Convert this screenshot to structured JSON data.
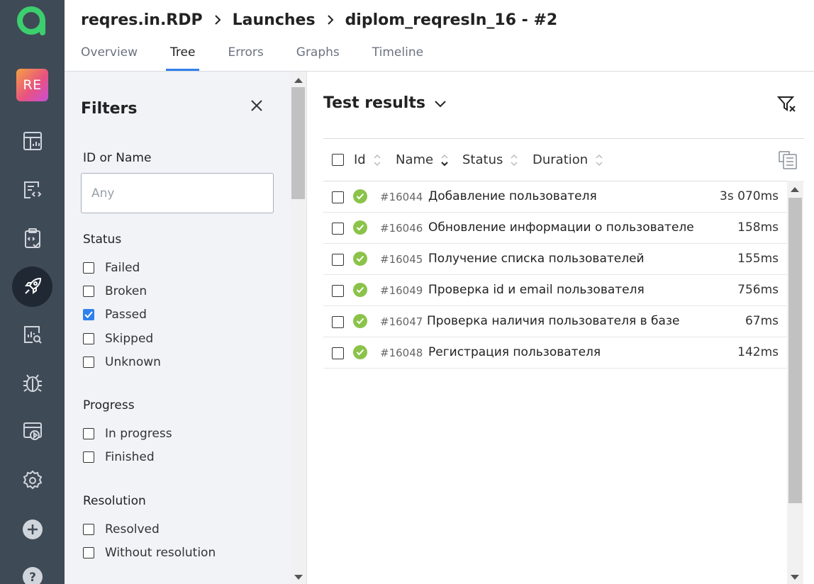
{
  "breadcrumb": {
    "project": "reqres.in.RDP",
    "launches": "Launches",
    "launch": "diplom_reqresIn_16 - #2"
  },
  "tabs": [
    {
      "label": "Overview"
    },
    {
      "label": "Tree"
    },
    {
      "label": "Errors"
    },
    {
      "label": "Graphs"
    },
    {
      "label": "Timeline"
    }
  ],
  "active_tab": "Tree",
  "rail": {
    "project_initials": "RE",
    "icons": [
      "dashboard-icon",
      "reports-icon",
      "test-plan-icon",
      "launches-icon",
      "analytics-icon",
      "defects-icon",
      "jobs-icon",
      "settings-icon",
      "add-icon",
      "help-icon"
    ]
  },
  "filters": {
    "title": "Filters",
    "id_or_name": {
      "label": "ID or Name",
      "placeholder": "Any",
      "value": ""
    },
    "status": {
      "label": "Status",
      "options": [
        {
          "label": "Failed",
          "checked": false
        },
        {
          "label": "Broken",
          "checked": false
        },
        {
          "label": "Passed",
          "checked": true
        },
        {
          "label": "Skipped",
          "checked": false
        },
        {
          "label": "Unknown",
          "checked": false
        }
      ]
    },
    "progress": {
      "label": "Progress",
      "options": [
        {
          "label": "In progress",
          "checked": false
        },
        {
          "label": "Finished",
          "checked": false
        }
      ]
    },
    "resolution": {
      "label": "Resolution",
      "options": [
        {
          "label": "Resolved",
          "checked": false
        },
        {
          "label": "Without resolution",
          "checked": false
        }
      ]
    }
  },
  "results": {
    "title": "Test results",
    "columns": [
      "Id",
      "Name",
      "Status",
      "Duration"
    ],
    "rows": [
      {
        "id": "#16044",
        "name": "Добавление пользователя",
        "duration": "3s 070ms",
        "status": "passed"
      },
      {
        "id": "#16046",
        "name": "Обновление информации о пользователе",
        "duration": "158ms",
        "status": "passed"
      },
      {
        "id": "#16045",
        "name": "Получение списка пользователей",
        "duration": "155ms",
        "status": "passed"
      },
      {
        "id": "#16049",
        "name": "Проверка id и email пользователя",
        "duration": "756ms",
        "status": "passed"
      },
      {
        "id": "#16047",
        "name": "Проверка наличия пользователя в базе",
        "duration": "67ms",
        "status": "passed"
      },
      {
        "id": "#16048",
        "name": "Регистрация пользователя",
        "duration": "142ms",
        "status": "passed"
      }
    ]
  },
  "colors": {
    "rail": "#3f4a57",
    "accent": "#2f80ed",
    "passed": "#8bc34a",
    "logo": "#3ccf6e"
  }
}
